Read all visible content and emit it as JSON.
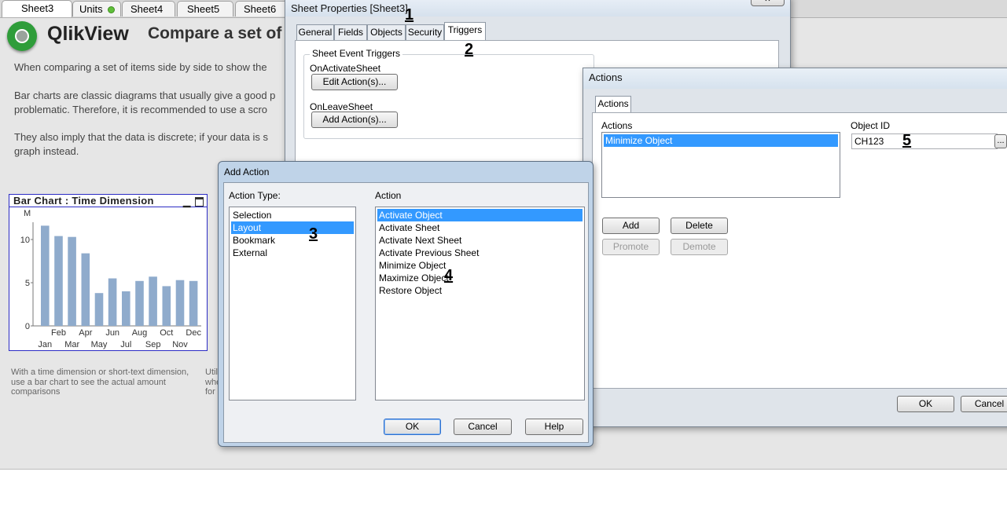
{
  "qlikview": {
    "tabs": [
      {
        "label": "Sheet3",
        "active": true
      },
      {
        "label": "Units",
        "has_status_dot": true
      },
      {
        "label": "Sheet4"
      },
      {
        "label": "Sheet5"
      },
      {
        "label": "Sheet6"
      }
    ],
    "brand": "QlikView",
    "page_title": "Compare a set of",
    "paragraphs": [
      "When comparing a set of items side by side to show the",
      "Bar charts are classic diagrams that usually give a good p",
      "problematic. Therefore, it is recommended to use a scro",
      "They also imply that the data is discrete; if your data is s",
      "graph instead."
    ],
    "note_left": [
      "With a time dimension or short-text dimension,",
      "use a bar chart to see the actual amount",
      "comparisons"
    ],
    "note_right": [
      "Util",
      "whe",
      "for"
    ]
  },
  "chart_data": {
    "type": "bar",
    "title": "Bar Chart : Time Dimension",
    "ylabel": "M",
    "ylim": [
      0,
      12
    ],
    "yticks": [
      "0",
      "5",
      "10"
    ],
    "categories": [
      "Jan",
      "Feb",
      "Mar",
      "Apr",
      "May",
      "Jun",
      "Jul",
      "Aug",
      "Sep",
      "Oct",
      "Nov",
      "Dec"
    ],
    "tick_labels_top": [
      "Feb",
      "Apr",
      "Jun",
      "Aug",
      "Oct",
      "Dec"
    ],
    "tick_labels_bottom": [
      "Jan",
      "Mar",
      "May",
      "Jul",
      "Sep",
      "Nov"
    ],
    "values": [
      11.6,
      10.4,
      10.3,
      8.4,
      3.8,
      5.5,
      4.0,
      5.2,
      5.7,
      4.6,
      5.3,
      5.2
    ],
    "bar_color": "#8fabcc",
    "grid": false
  },
  "sheet_properties": {
    "title": "Sheet Properties [Sheet3]",
    "close_label": "✕",
    "tabs": [
      "General",
      "Fields",
      "Objects",
      "Security",
      "Triggers"
    ],
    "active_tab": "Triggers",
    "group_label": "Sheet Event Triggers",
    "on_activate_label": "OnActivateSheet",
    "edit_actions_label": "Edit Action(s)...",
    "on_leave_label": "OnLeaveSheet",
    "add_actions_label": "Add Action(s)..."
  },
  "actions_dialog": {
    "title": "Actions",
    "tab_label": "Actions",
    "actions_header": "Actions",
    "actions_list": [
      "Minimize Object"
    ],
    "object_id_label": "Object ID",
    "object_id_value": "CH123",
    "browse_label": "...",
    "add_label": "Add",
    "delete_label": "Delete",
    "promote_label": "Promote",
    "demote_label": "Demote",
    "ok_label": "OK",
    "cancel_label": "Cancel"
  },
  "add_action_dialog": {
    "title": "Add Action",
    "action_type_label": "Action Type:",
    "action_types": [
      "Selection",
      "Layout",
      "Bookmark",
      "External"
    ],
    "selected_type": "Layout",
    "action_label": "Action",
    "actions": [
      "Activate Object",
      "Activate Sheet",
      "Activate Next Sheet",
      "Activate Previous Sheet",
      "Minimize Object",
      "Maximize Object",
      "Restore Object"
    ],
    "selected_action": "Activate Object",
    "ok_label": "OK",
    "cancel_label": "Cancel",
    "help_label": "Help"
  },
  "annotations": [
    "1",
    "2",
    "3",
    "4",
    "5"
  ]
}
